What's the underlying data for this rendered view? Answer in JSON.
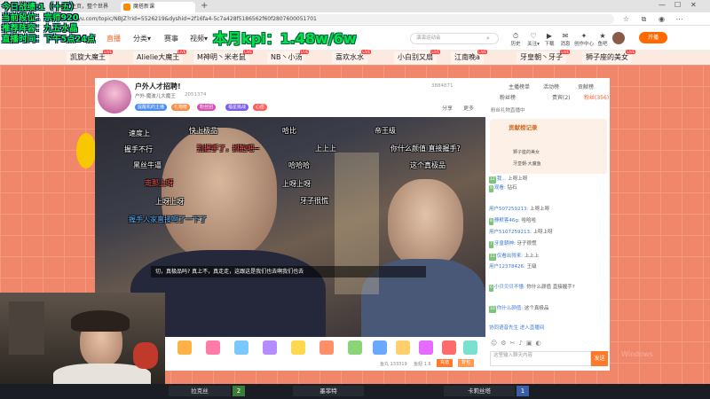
{
  "browser": {
    "tabs": [
      {
        "label": "主页，整个世界"
      },
      {
        "label": "魔搭新课"
      }
    ],
    "new_tab": "+",
    "url": "www.douyu.com/topic/NBJZ?rid=5526219&dyshid=2f16fa4-5c7a428f5186562f60f2807600051701",
    "icons": [
      "back-icon",
      "forward-icon",
      "refresh-icon",
      "home-icon"
    ]
  },
  "overlay": {
    "line1": "今日战绩:1（十五）",
    "line2": "当前段位：宗师920",
    "line3": "推荐阵容：九五水晶",
    "line4": "直播时间：下午5点24点",
    "kpi": "本月kpi：1.48w/6w"
  },
  "site": {
    "nav": [
      "直播",
      "分类▾",
      "赛事",
      "视频▾"
    ],
    "search_placeholder": "演演运动会",
    "header_icons": [
      {
        "glyph": "⏱",
        "label": "历史"
      },
      {
        "glyph": "♡",
        "label": "关注▾"
      },
      {
        "glyph": "▶",
        "label": "下载"
      },
      {
        "glyph": "✉",
        "label": "消息"
      },
      {
        "glyph": "✦",
        "label": "创作中心"
      },
      {
        "glyph": "★",
        "label": "鱼吧"
      }
    ],
    "start_live": "开播"
  },
  "recommend": [
    "凯旋大魔王",
    "Alielie大魔王",
    "M神明丶米老鼠",
    "NB丶小汤",
    "喜欢水水",
    "小白别又扇",
    "江南晚a",
    "牙皇朝丶牙子",
    "狮子座的美女"
  ],
  "room": {
    "title": "户外人才招聘!",
    "owner": "户外·魔波儿大魔王",
    "id": "2051374",
    "tags": [
      "提醒机的主播",
      "礼物榜",
      "粉丝团",
      "福星挑战",
      "心愿"
    ],
    "stats": "3884871",
    "share": "分享",
    "more": "更多"
  },
  "danmaku": [
    {
      "t": "速度上",
      "c": ""
    },
    {
      "t": "快上极品",
      "c": ""
    },
    {
      "t": "哈比",
      "c": ""
    },
    {
      "t": "帝王级",
      "c": ""
    },
    {
      "t": "握手不行",
      "c": ""
    },
    {
      "t": "别握手了，抓抱吧~",
      "c": "r"
    },
    {
      "t": "上上上",
      "c": ""
    },
    {
      "t": "你什么颜值 直接握手?",
      "c": ""
    },
    {
      "t": "黑丝牛逼",
      "c": ""
    },
    {
      "t": "哈哈哈",
      "c": ""
    },
    {
      "t": "这个真极品",
      "c": ""
    },
    {
      "t": "走那上呀",
      "c": "r"
    },
    {
      "t": "上呀上呀",
      "c": ""
    },
    {
      "t": "上呀上呀",
      "c": ""
    },
    {
      "t": "牙子很慌",
      "c": ""
    },
    {
      "t": "握手人家直接啊了一下了",
      "c": "b"
    }
  ],
  "subtitle": "切，真极品吗? 真上不，真走走，这跟这是我们也去啊我们也去",
  "gifts": {
    "fans": "鱼丸 133319",
    "balance": "鱼翅 1.6",
    "recharge": "充值",
    "bag": "背包"
  },
  "chat": {
    "tabs": [
      "主播榜单",
      "活动榜",
      "贡献榜"
    ],
    "subtabs": [
      "粉丝榜",
      "贵宾(2)",
      "粉丝(356)"
    ],
    "notice": "粉丝礼物直播中",
    "rank_title": "贡献榜记录",
    "rank": [
      "狮子座的美女",
      "牙皇朝·大魔鱼"
    ],
    "messages": [
      {
        "u": "我...",
        "m": "上呀上呀"
      },
      {
        "u": "观看:",
        "m": "钻石"
      },
      {
        "u": "用户507259213:",
        "m": "上呀上呀"
      },
      {
        "u": "静默客46g:",
        "m": "哈哈哈"
      },
      {
        "u": "用户5107259213:",
        "m": "上呀上呀"
      },
      {
        "u": "牙皇朝神:",
        "m": "牙子很慌"
      },
      {
        "u": "仅看出得来:",
        "m": "上上上"
      },
      {
        "u": "用户12378426:",
        "m": "王级"
      },
      {
        "u": "小贝贝贝不懂:",
        "m": "你什么颜值 直接握手?"
      },
      {
        "u": "你什么颜值:",
        "m": "这个真极品"
      },
      {
        "u": "协同语音先生",
        "m": "进入直播间"
      }
    ],
    "input_placeholder": "这里输入聊天内容",
    "send": "发送"
  },
  "bottom": {
    "players": [
      "拉克丝",
      "墨菲特",
      "卡莉丝塔"
    ],
    "scores": [
      "2",
      "",
      "1"
    ]
  },
  "watermark": "Windows"
}
